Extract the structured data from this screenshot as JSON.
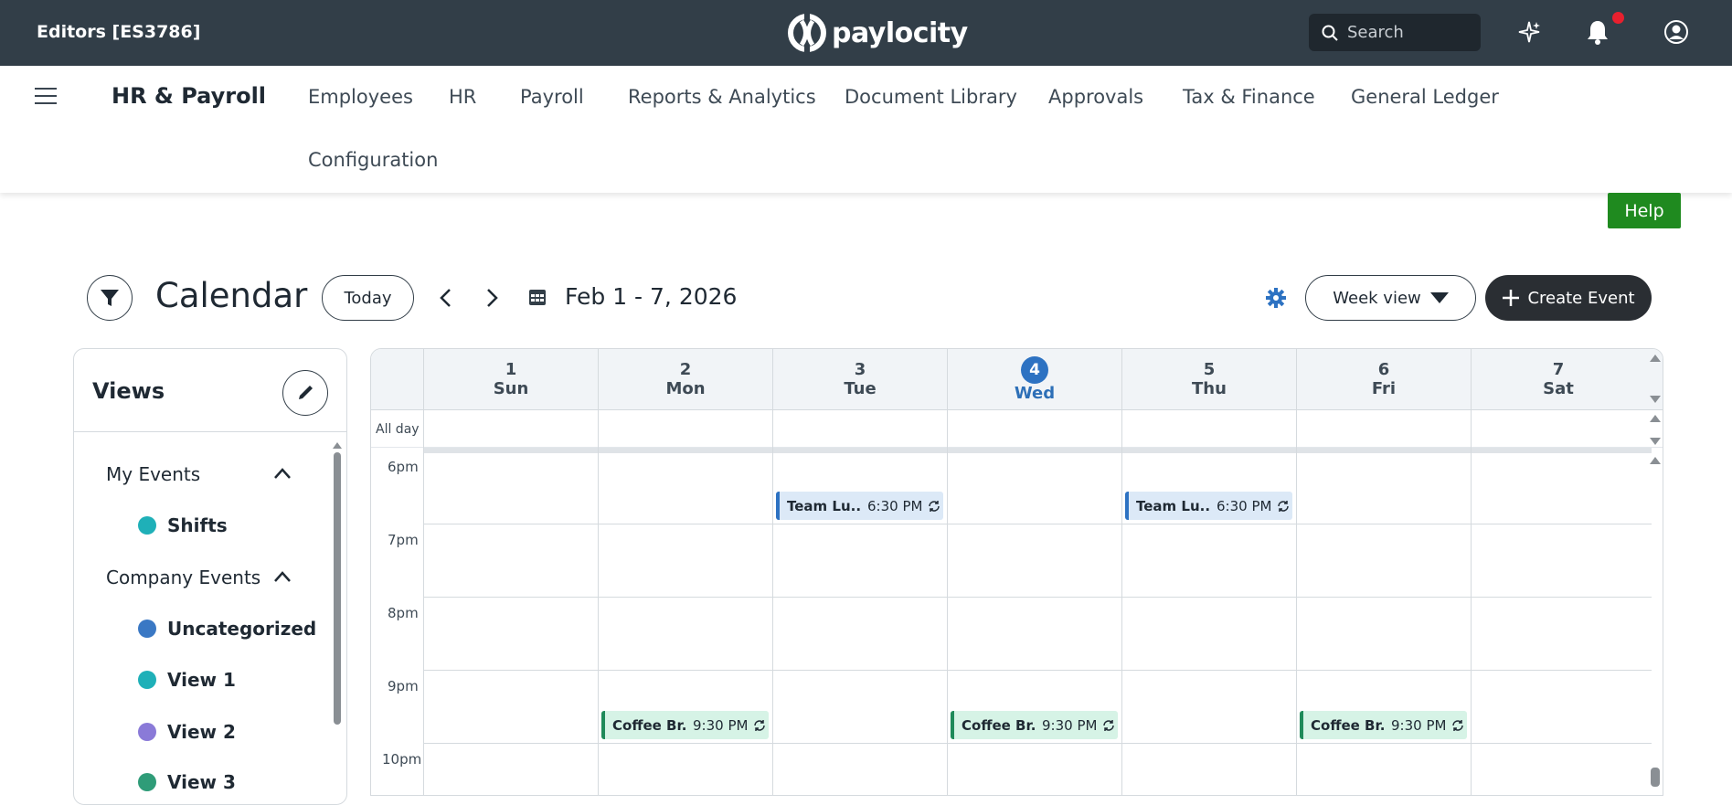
{
  "topbar": {
    "company": "Editors [ES3786]",
    "logo_text": "paylocity",
    "search_placeholder": "Search",
    "icons": [
      "search-icon",
      "sparkle-icon",
      "bell-icon",
      "user-icon"
    ],
    "colors": {
      "background": "#323e48",
      "notification": "#e8202e"
    }
  },
  "nav": {
    "module_title": "HR & Payroll",
    "items": [
      "Employees",
      "HR",
      "Payroll",
      "Reports & Analytics",
      "Document Library",
      "Approvals",
      "Tax & Finance",
      "General Ledger",
      "Configuration"
    ]
  },
  "help": {
    "label": "Help",
    "color": "#1f8a1f"
  },
  "calendar": {
    "title": "Calendar",
    "today_label": "Today",
    "date_range": "Feb 1 - 7, 2026",
    "view_label": "Week view",
    "create_label": "Create Event",
    "allday_label": "All day",
    "days": [
      {
        "num": "1",
        "name": "Sun",
        "today": false
      },
      {
        "num": "2",
        "name": "Mon",
        "today": false
      },
      {
        "num": "3",
        "name": "Tue",
        "today": false
      },
      {
        "num": "4",
        "name": "Wed",
        "today": true
      },
      {
        "num": "5",
        "name": "Thu",
        "today": false
      },
      {
        "num": "6",
        "name": "Fri",
        "today": false
      },
      {
        "num": "7",
        "name": "Sat",
        "today": false
      }
    ],
    "times": [
      "6pm",
      "7pm",
      "8pm",
      "9pm",
      "10pm"
    ],
    "events": [
      {
        "name": "Team Lu...",
        "time": "6:30 PM",
        "day": "Tue",
        "type": "blue"
      },
      {
        "name": "Team Lu...",
        "time": "6:30 PM",
        "day": "Thu",
        "type": "blue"
      },
      {
        "name": "Coffee Br...",
        "time": "9:30 PM",
        "day": "Mon",
        "type": "green"
      },
      {
        "name": "Coffee Br...",
        "time": "9:30 PM",
        "day": "Wed",
        "type": "green"
      },
      {
        "name": "Coffee Br...",
        "time": "9:30 PM",
        "day": "Fri",
        "type": "green"
      }
    ],
    "colors": {
      "today": "#2d72c2",
      "event_blue": "#dce9f7",
      "event_green": "#d6f3e6"
    }
  },
  "views": {
    "title": "Views",
    "groups": [
      {
        "label": "My Events",
        "items": [
          {
            "label": "Shifts",
            "color": "#1fb0b8"
          }
        ]
      },
      {
        "label": "Company Events",
        "items": [
          {
            "label": "Uncategorized",
            "color": "#3a78c4"
          },
          {
            "label": "View 1",
            "color": "#1fb0b8"
          },
          {
            "label": "View 2",
            "color": "#8a7ad8"
          },
          {
            "label": "View 3",
            "color": "#2f9c78"
          }
        ]
      }
    ]
  }
}
